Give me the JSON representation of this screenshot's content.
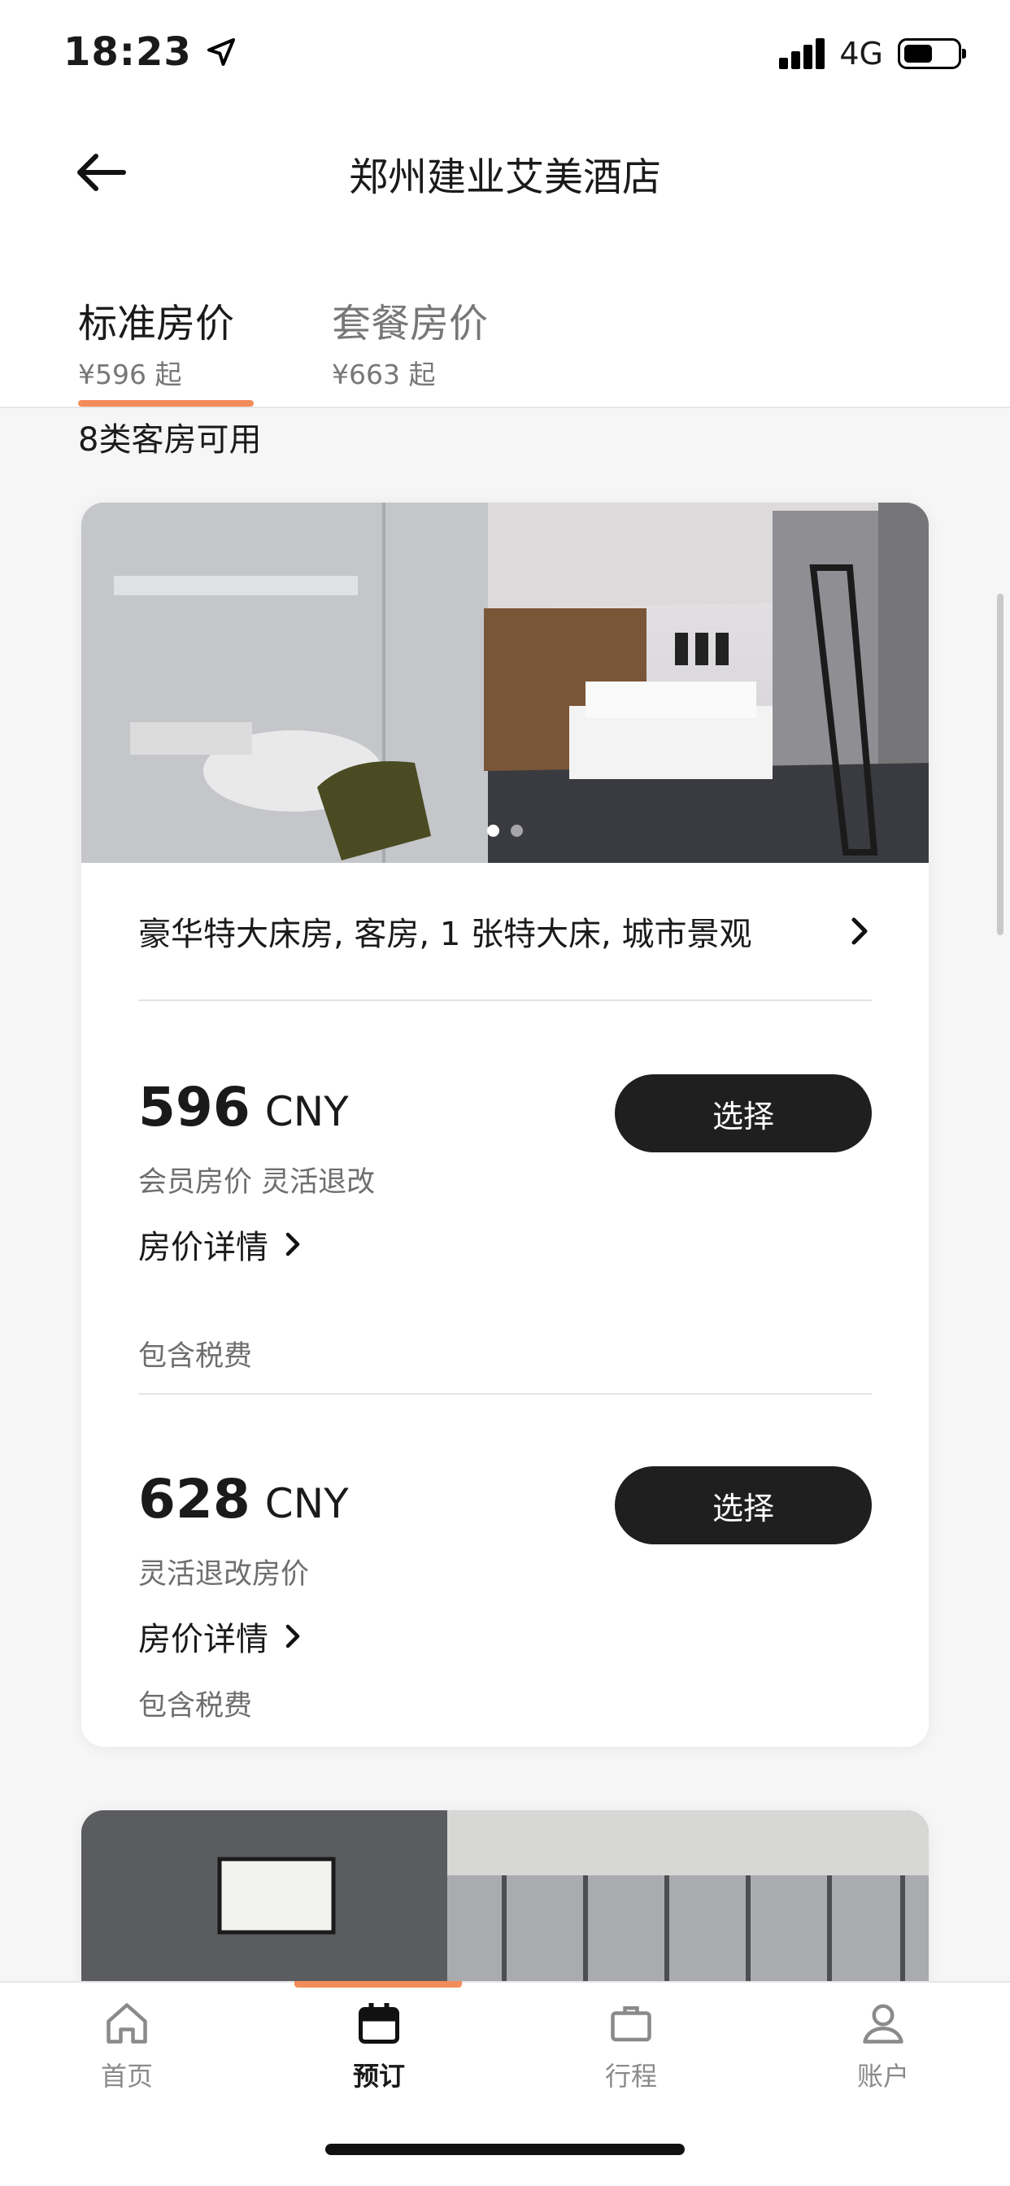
{
  "status_bar": {
    "time": "18:23",
    "network": "4G"
  },
  "nav": {
    "title": "郑州建业艾美酒店"
  },
  "tabs": [
    {
      "label": "标准房价",
      "price": "¥596 起",
      "active": true
    },
    {
      "label": "套餐房价",
      "price": "¥663 起",
      "active": false
    }
  ],
  "room_count": "8类客房可用",
  "rooms": [
    {
      "name": "豪华特大床房, 客房, 1 张特大床, 城市景观",
      "rates": [
        {
          "price": "596",
          "currency": "CNY",
          "description": "会员房价 灵活退改",
          "details_link": "房价详情",
          "tax_note": "包含税费",
          "button": "选择"
        },
        {
          "price": "628",
          "currency": "CNY",
          "description": "灵活退改房价",
          "details_link": "房价详情",
          "tax_note": "包含税费",
          "button": "选择"
        }
      ]
    }
  ],
  "bottom_nav": [
    {
      "label": "首页",
      "icon": "home-icon",
      "active": false
    },
    {
      "label": "预订",
      "icon": "calendar-icon",
      "active": true
    },
    {
      "label": "行程",
      "icon": "briefcase-icon",
      "active": false
    },
    {
      "label": "账户",
      "icon": "user-icon",
      "active": false
    }
  ],
  "colors": {
    "accent": "#f28c5a",
    "button": "#1f1f1f"
  }
}
